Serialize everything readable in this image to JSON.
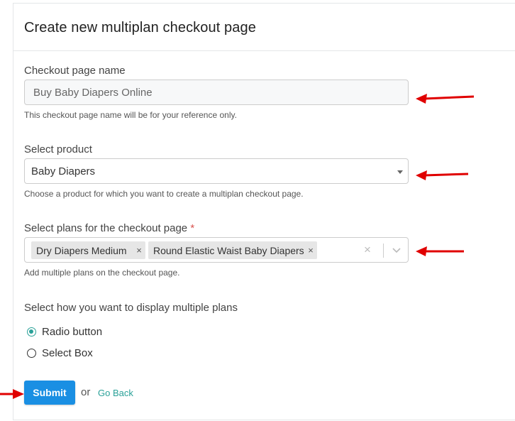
{
  "page": {
    "title": "Create new multiplan checkout page"
  },
  "checkout_name": {
    "label": "Checkout page name",
    "value": "Buy Baby Diapers Online",
    "help": "This checkout page name will be for your reference only."
  },
  "product": {
    "label": "Select product",
    "selected": "Baby Diapers",
    "help": "Choose a product for which you want to create a multiplan checkout page."
  },
  "plans": {
    "label": "Select plans for the checkout page",
    "required_mark": "*",
    "tags": [
      {
        "label": "Dry Diapers Medium",
        "remove": "×"
      },
      {
        "label": "Round Elastic Waist Baby Diapers",
        "remove": "×"
      }
    ],
    "clear": "×",
    "help": "Add multiple plans on the checkout page."
  },
  "display": {
    "label": "Select how you want to display multiple plans",
    "options": [
      {
        "label": "Radio button",
        "checked": true
      },
      {
        "label": "Select Box",
        "checked": false
      }
    ]
  },
  "actions": {
    "submit_label": "Submit",
    "or_text": "or",
    "go_back_label": "Go Back"
  },
  "colors": {
    "accent": "#2aa198",
    "submit": "#1a8fe3",
    "annotation_arrow": "#e00000"
  }
}
